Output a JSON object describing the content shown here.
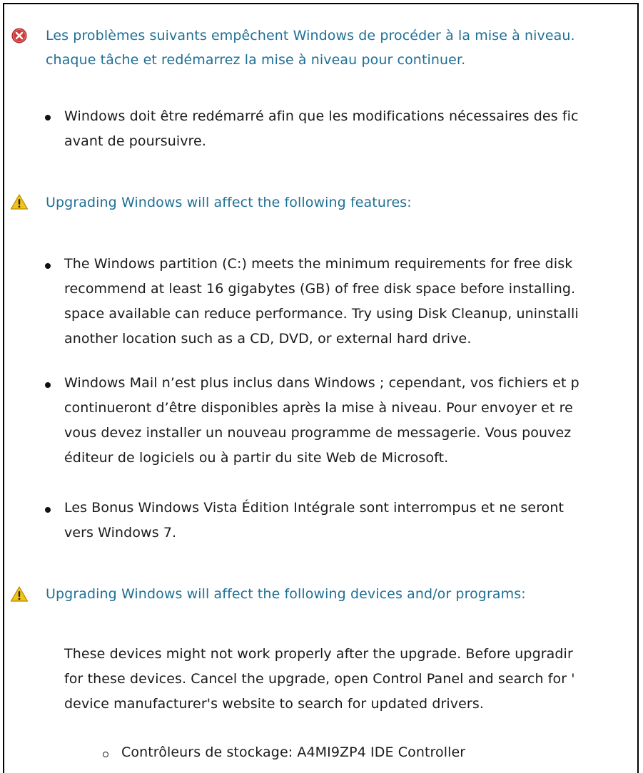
{
  "error_section": {
    "icon": "error-icon",
    "icon_color": "#d23a3a",
    "heading_lines": [
      "Les problèmes suivants empêchent Windows de procéder à la mise à niveau.",
      "chaque tâche et redémarrez la mise à niveau pour continuer."
    ],
    "items": [
      {
        "lines": [
          "Windows doit être redémarré afin que les modifications nécessaires des fic",
          "avant de poursuivre."
        ]
      }
    ]
  },
  "features_section": {
    "icon": "warning-icon",
    "icon_color": "#f0c419",
    "heading": "Upgrading Windows will affect the following features:",
    "items": [
      {
        "lines": [
          "The Windows partition (C:) meets the minimum requirements for free disk",
          "recommend at least 16 gigabytes (GB) of free disk space before installing.",
          "space available can reduce performance. Try using Disk Cleanup, uninstalli",
          "another location such as a CD, DVD, or external hard drive."
        ]
      },
      {
        "lines": [
          "Windows Mail n’est plus inclus dans Windows ; cependant, vos fichiers et p",
          "continueront d’être disponibles après la mise à niveau. Pour envoyer et re",
          "vous devez installer un nouveau programme de messagerie. Vous pouvez",
          "éditeur de logiciels ou à partir du site Web de Microsoft."
        ]
      },
      {
        "lines": [
          "Les Bonus Windows Vista Édition Intégrale sont interrompus et ne seront",
          "vers Windows 7."
        ]
      }
    ]
  },
  "devices_section": {
    "icon": "warning-icon",
    "icon_color": "#f0c419",
    "heading": "Upgrading Windows will affect the following devices and/or programs:",
    "description_lines": [
      "These devices might not work properly after the upgrade. Before upgradir",
      "for these devices. Cancel the upgrade, open Control Panel and search for '",
      "device manufacturer's website to search for updated drivers."
    ],
    "subitems": [
      "Contrôleurs de stockage: A4MI9ZP4 IDE Controller"
    ]
  },
  "colors": {
    "heading": "#1f6f95",
    "body_text": "#1a1a1a"
  }
}
